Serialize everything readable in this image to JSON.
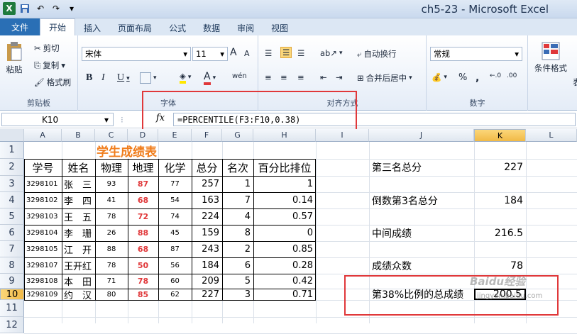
{
  "window": {
    "title": "ch5-23 - Microsoft Excel",
    "logo": "X"
  },
  "ribbon_tabs": [
    "文件",
    "开始",
    "插入",
    "页面布局",
    "公式",
    "数据",
    "审阅",
    "视图"
  ],
  "clipboard": {
    "paste": "粘贴",
    "cut": "剪切",
    "copy": "复制",
    "format_painter": "格式刷",
    "label": "剪贴板"
  },
  "font": {
    "name": "宋体",
    "size": "11",
    "bold": "B",
    "italic": "I",
    "underline": "U",
    "grow": "A",
    "shrink": "A",
    "color_a": "A",
    "phonetic": "wén",
    "label": "字体"
  },
  "alignment": {
    "wrap": "自动换行",
    "merge": "合并后居中",
    "label": "对齐方式"
  },
  "number": {
    "format": "常规",
    "percent": "%",
    "comma": ",",
    "label": "数字"
  },
  "styles": {
    "conditional": "条件格式",
    "table_partial": "表"
  },
  "formula_bar": {
    "cell_ref": "K10",
    "fx": "fx",
    "formula": "=PERCENTILE(F3:F10,0.38)"
  },
  "columns": [
    "A",
    "B",
    "C",
    "D",
    "E",
    "F",
    "G",
    "H",
    "I",
    "J",
    "K",
    "L"
  ],
  "rows": [
    "1",
    "2",
    "3",
    "4",
    "5",
    "6",
    "7",
    "8",
    "9",
    "10",
    "11",
    "12"
  ],
  "sheet": {
    "title": "学生成绩表",
    "headers": [
      "学号",
      "姓名",
      "物理",
      "地理",
      "化学",
      "总分",
      "名次",
      "百分比排位"
    ],
    "records": [
      {
        "id": "3298101",
        "name": "张　三",
        "physics": "93",
        "geo": "87",
        "chem": "77",
        "total": "257",
        "rank": "1",
        "pct": "1"
      },
      {
        "id": "3298102",
        "name": "李　四",
        "physics": "41",
        "geo": "68",
        "chem": "54",
        "total": "163",
        "rank": "7",
        "pct": "0.14"
      },
      {
        "id": "3298103",
        "name": "王　五",
        "physics": "78",
        "geo": "72",
        "chem": "74",
        "total": "224",
        "rank": "4",
        "pct": "0.57"
      },
      {
        "id": "3298104",
        "name": "李　珊",
        "physics": "26",
        "geo": "88",
        "chem": "45",
        "total": "159",
        "rank": "8",
        "pct": "0"
      },
      {
        "id": "3298105",
        "name": "江　开",
        "physics": "88",
        "geo": "68",
        "chem": "87",
        "total": "243",
        "rank": "2",
        "pct": "0.85"
      },
      {
        "id": "3298107",
        "name": "王开红",
        "physics": "78",
        "geo": "50",
        "chem": "56",
        "total": "184",
        "rank": "6",
        "pct": "0.28"
      },
      {
        "id": "3298108",
        "name": "本　田",
        "physics": "71",
        "geo": "78",
        "chem": "60",
        "total": "209",
        "rank": "5",
        "pct": "0.42"
      },
      {
        "id": "3298109",
        "name": "约　汉",
        "physics": "80",
        "geo": "85",
        "chem": "62",
        "total": "227",
        "rank": "3",
        "pct": "0.71"
      }
    ],
    "stats": [
      {
        "label": "第三名总分",
        "value": "227"
      },
      {
        "label": "倒数第3名总分",
        "value": "184"
      },
      {
        "label": "中间成绩",
        "value": "216.5"
      },
      {
        "label": "成绩众数",
        "value": "78"
      },
      {
        "label": "第38%比例的总成绩",
        "value": "200.5"
      }
    ]
  },
  "watermark": {
    "line1": "Baidu经验",
    "line2": "jingyan.baidu.com"
  },
  "colors": {
    "title_orange": "#f07d1c",
    "geo_red": "#e0383a",
    "highlight_box": "#e0383a",
    "file_tab": "#2a6fb5"
  }
}
